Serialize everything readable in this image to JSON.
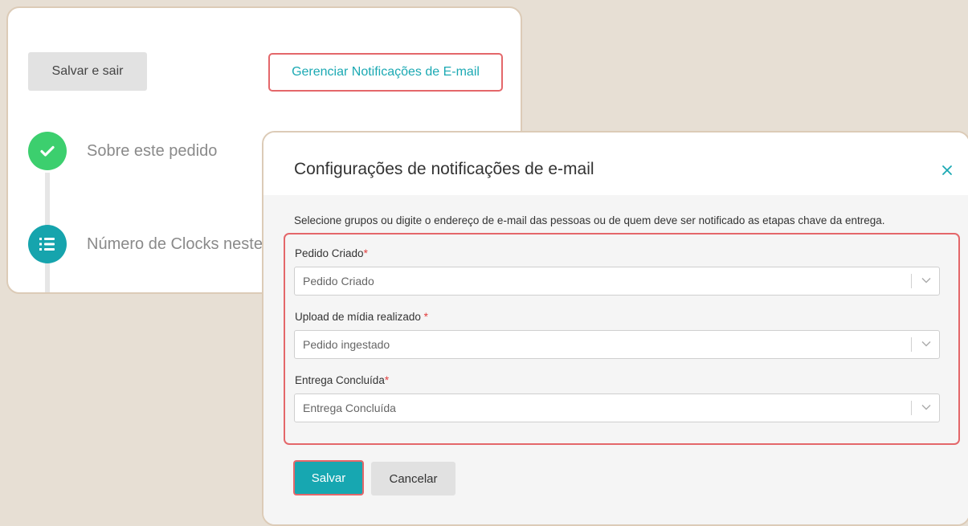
{
  "background_panel": {
    "save_exit_label": "Salvar e sair",
    "manage_notifications_label": "Gerenciar Notificações de E-mail",
    "steps": [
      {
        "label": "Sobre este pedido",
        "icon": "check-icon"
      },
      {
        "label": "Número de Clocks neste pedido",
        "icon": "list-numbered-icon"
      }
    ]
  },
  "modal": {
    "title": "Configurações de notificações de e-mail",
    "close_icon": "close-icon",
    "description": "Selecione grupos ou digite o endereço de e-mail das pessoas ou de quem deve ser notificado as etapas chave da entrega.",
    "fields": [
      {
        "label": "Pedido Criado",
        "required_mark": "*",
        "value": "Pedido Criado"
      },
      {
        "label": "Upload de mídia realizado ",
        "required_mark": "*",
        "value": "Pedido ingestado"
      },
      {
        "label": "Entrega Concluída",
        "required_mark": "*",
        "value": "Entrega Concluída"
      }
    ],
    "save_label": "Salvar",
    "cancel_label": "Cancelar"
  },
  "colors": {
    "accent": "#17a7b1",
    "highlight_border": "#e4676a",
    "success": "#3ccf6e",
    "background": "#e7dfd4"
  }
}
